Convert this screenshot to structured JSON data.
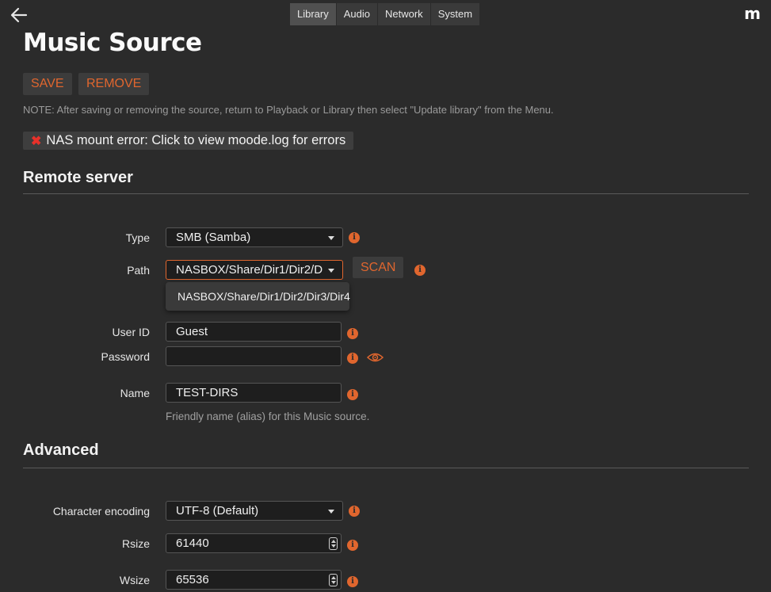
{
  "nav": {
    "tabs": [
      "Library",
      "Audio",
      "Network",
      "System"
    ],
    "active_tab": "Library",
    "brand": "m"
  },
  "page": {
    "title": "Music Source",
    "save_label": "SAVE",
    "remove_label": "REMOVE",
    "note": "NOTE: After saving or removing the source, return to Playback or Library then select \"Update library\" from the Menu.",
    "error_icon": "✖",
    "error_text": "NAS mount error: Click to view moode.log for errors"
  },
  "remote_server": {
    "title": "Remote server",
    "type_label": "Type",
    "type_value": "SMB (Samba)",
    "path_label": "Path",
    "path_value": "NASBOX/Share/Dir1/Dir2/D",
    "scan_label": "SCAN",
    "path_option": "NASBOX/Share/Dir1/Dir2/Dir3/Dir4",
    "userid_label": "User ID",
    "userid_value": "Guest",
    "password_label": "Password",
    "password_value": "",
    "name_label": "Name",
    "name_value": "TEST-DIRS",
    "name_help": "Friendly name (alias) for this Music source."
  },
  "advanced": {
    "title": "Advanced",
    "charset_label": "Character encoding",
    "charset_value": "UTF-8 (Default)",
    "rsize_label": "Rsize",
    "rsize_value": "61440",
    "wsize_label": "Wsize",
    "wsize_value": "65536"
  },
  "icons": {
    "info": "i",
    "accent_color": "#e0662e",
    "error_color": "#e8312a"
  }
}
